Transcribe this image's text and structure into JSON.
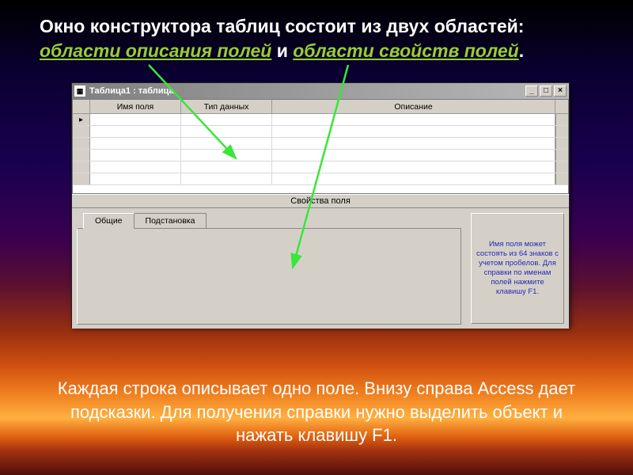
{
  "heading": {
    "part1": "Окно конструктора таблиц состоит из двух областей:",
    "accent1": "области описания полей",
    "conj": " и ",
    "accent2": "области свойств полей",
    "period": "."
  },
  "window": {
    "title": "Таблица1 : таблица",
    "columns": {
      "field_name": "Имя поля",
      "data_type": "Тип данных",
      "description": "Описание"
    },
    "row_marker": "▸",
    "properties_caption": "Свойства поля",
    "tabs": {
      "general": "Общие",
      "lookup": "Подстановка"
    },
    "hint": "Имя поля может состоять из 64 знаков с учетом пробелов. Для справки по именам полей нажмите клавишу F1."
  },
  "bottom_text": "Каждая строка описывает одно поле. Внизу справа Access дает подсказки. Для получения справки нужно выделить объект и нажать клавишу F1."
}
